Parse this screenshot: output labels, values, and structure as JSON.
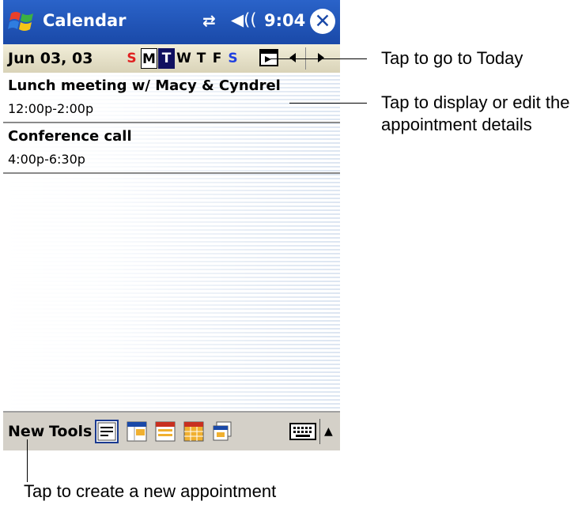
{
  "titlebar": {
    "app_title": "Calendar",
    "time": "9:04"
  },
  "datebar": {
    "date": "Jun 03, 03",
    "days": [
      {
        "letter": "S",
        "color": "#e02020",
        "bg": "transparent",
        "border": "none"
      },
      {
        "letter": "M",
        "color": "#000000",
        "bg": "#ffffff",
        "border": "1px solid #000"
      },
      {
        "letter": "T",
        "color": "#ffffff",
        "bg": "#101060",
        "border": "none"
      },
      {
        "letter": "W",
        "color": "#000000",
        "bg": "transparent",
        "border": "none"
      },
      {
        "letter": "T",
        "color": "#000000",
        "bg": "transparent",
        "border": "none"
      },
      {
        "letter": "F",
        "color": "#000000",
        "bg": "transparent",
        "border": "none"
      },
      {
        "letter": "S",
        "color": "#2040e0",
        "bg": "transparent",
        "border": "none"
      }
    ]
  },
  "appointments": [
    {
      "title": "Lunch meeting  w/ Macy & Cyndrel",
      "time": "12:00p-2:00p"
    },
    {
      "title": "Conference call",
      "time": "4:00p-6:30p"
    }
  ],
  "toolbar": {
    "new_label": "New",
    "tools_label": "Tools"
  },
  "callouts": {
    "today": "Tap to go to Today",
    "details_line1": "Tap to display or edit the",
    "details_line2": "appointment details",
    "new": "Tap to create a new appointment"
  },
  "colors": {
    "title_bar": "#1a49a8",
    "today_bg": "#101060",
    "sunday": "#e02020",
    "saturday": "#2040e0"
  }
}
